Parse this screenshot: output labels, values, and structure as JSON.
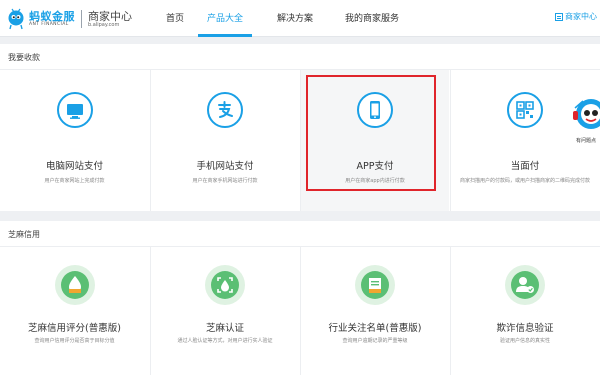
{
  "header": {
    "logo_cn": "蚂蚁金服",
    "logo_en": "ANT FINANCIAL",
    "logo_sub": "商家中心",
    "logo_url": "b.alipay.com",
    "nav": [
      {
        "label": "首页"
      },
      {
        "label": "产品大全"
      },
      {
        "label": "解决方案"
      },
      {
        "label": "我的商家服务"
      }
    ],
    "merchant_center": "商家中心"
  },
  "section_pay": {
    "title": "我要收款",
    "cards": [
      {
        "title": "电脑网站支付",
        "desc": "用户在商家网站上完成付款",
        "icon": "monitor-icon"
      },
      {
        "title": "手机网站支付",
        "desc": "用户在商家手机网站进行付款",
        "icon": "alipay-icon"
      },
      {
        "title": "APP支付",
        "desc": "用户在商家app内进行付款",
        "icon": "phone-icon"
      },
      {
        "title": "当面付",
        "desc": "商家扫描用户的付款码，或用户扫描商家的二维码完成付款",
        "icon": "qrcode-icon"
      }
    ]
  },
  "section_credit": {
    "title": "芝麻信用",
    "cards": [
      {
        "title": "芝麻信用评分(普惠版)",
        "desc": "查询用户信用评分是否高于目标分值",
        "icon": "sesame-score-icon"
      },
      {
        "title": "芝麻认证",
        "desc": "通过人脸认证等方式，对用户进行实人验证",
        "icon": "sesame-verify-icon"
      },
      {
        "title": "行业关注名单(普惠版)",
        "desc": "查询用户逾期记录的严重等级",
        "icon": "watchlist-icon"
      },
      {
        "title": "欺诈信息验证",
        "desc": "验证用户信息的真实性",
        "icon": "user-verify-icon"
      }
    ]
  },
  "robot": {
    "label": "有问题点"
  },
  "colors": {
    "brand": "#1aa0e6",
    "highlight": "#e0252b",
    "credit": "#5bbf74"
  }
}
